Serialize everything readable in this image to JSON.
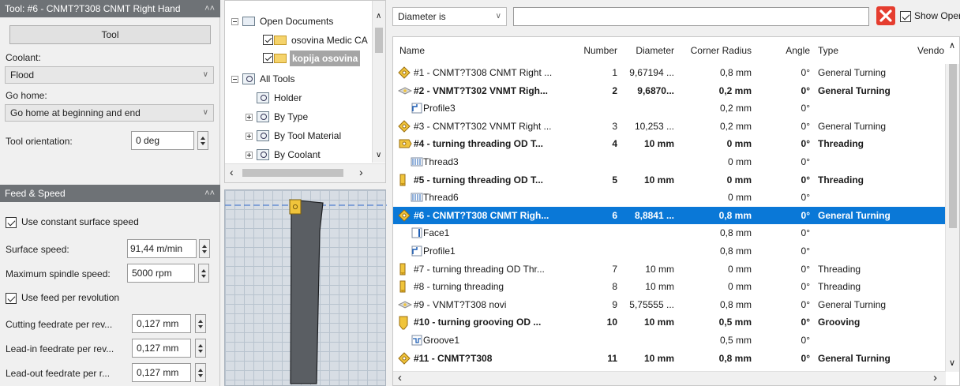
{
  "tool_panel": {
    "title": "Tool: #6 - CNMT?T308 CNMT Right Hand",
    "tool_button": "Tool",
    "coolant_label": "Coolant:",
    "coolant_value": "Flood",
    "go_home_label": "Go home:",
    "go_home_value": "Go home at beginning and end",
    "orientation_label": "Tool orientation:",
    "orientation_value": "0 deg"
  },
  "feed_speed": {
    "title": "Feed & Speed",
    "use_constant_surface_speed": "Use constant surface speed",
    "surface_speed_label": "Surface speed:",
    "surface_speed_value": "91,44 m/min",
    "max_spindle_label": "Maximum spindle speed:",
    "max_spindle_value": "5000 rpm",
    "use_feed_per_rev": "Use feed per revolution",
    "cutting_feed_label": "Cutting feedrate per rev...",
    "cutting_feed_value": "0,127 mm",
    "leadin_feed_label": "Lead-in feedrate per rev...",
    "leadin_feed_value": "0,127 mm",
    "leadout_feed_label": "Lead-out feedrate per r...",
    "leadout_feed_value": "0,127 mm"
  },
  "tree": {
    "open_documents": "Open Documents",
    "doc1": "osovina Medic CA",
    "doc2": "kopija osovina",
    "all_tools": "All Tools",
    "holder": "Holder",
    "by_type": "By Type",
    "by_tool_material": "By Tool Material",
    "by_coolant": "By Coolant"
  },
  "filter": {
    "field": "Diameter is",
    "show_operations": "Show Operations"
  },
  "list": {
    "columns": [
      "Name",
      "Number",
      "Diameter",
      "Corner Radius",
      "Angle",
      "Type",
      "Vendo"
    ],
    "rows": [
      {
        "icon": "turning-insert-icon",
        "name": "#1 - CNMT?T308 CNMT Right ...",
        "number": "1",
        "diameter": "9,67194 ...",
        "radius": "0,8 mm",
        "angle": "0°",
        "type": "General Turning",
        "bold": false,
        "indent": false
      },
      {
        "icon": "vnmt-insert-icon",
        "name": "#2 - VNMT?T302 VNMT Righ...",
        "number": "2",
        "diameter": "9,6870...",
        "radius": "0,2 mm",
        "angle": "0°",
        "type": "General Turning",
        "bold": true,
        "indent": false
      },
      {
        "icon": "profile-icon",
        "name": "Profile3",
        "number": "",
        "diameter": "",
        "radius": "0,2 mm",
        "angle": "0°",
        "type": "",
        "bold": false,
        "indent": true
      },
      {
        "icon": "turning-insert-icon",
        "name": "#3 - CNMT?T302 VNMT Right ...",
        "number": "3",
        "diameter": "10,253 ...",
        "radius": "0,2 mm",
        "angle": "0°",
        "type": "General Turning",
        "bold": false,
        "indent": false
      },
      {
        "icon": "threading-insert-icon",
        "name": "#4 - turning threading OD T...",
        "number": "4",
        "diameter": "10 mm",
        "radius": "0 mm",
        "angle": "0°",
        "type": "Threading",
        "bold": true,
        "indent": false
      },
      {
        "icon": "thread-icon",
        "name": "Thread3",
        "number": "",
        "diameter": "",
        "radius": "0 mm",
        "angle": "0°",
        "type": "",
        "bold": false,
        "indent": true
      },
      {
        "icon": "threading-tool-icon",
        "name": "#5 - turning threading OD T...",
        "number": "5",
        "diameter": "10 mm",
        "radius": "0 mm",
        "angle": "0°",
        "type": "Threading",
        "bold": true,
        "indent": false
      },
      {
        "icon": "thread-icon",
        "name": "Thread6",
        "number": "",
        "diameter": "",
        "radius": "0 mm",
        "angle": "0°",
        "type": "",
        "bold": false,
        "indent": true
      },
      {
        "icon": "turning-insert-icon",
        "name": "#6 - CNMT?T308 CNMT Righ...",
        "number": "6",
        "diameter": "8,8841 ...",
        "radius": "0,8 mm",
        "angle": "0°",
        "type": "General Turning",
        "bold": true,
        "indent": false,
        "selected": true
      },
      {
        "icon": "face-icon",
        "name": "Face1",
        "number": "",
        "diameter": "",
        "radius": "0,8 mm",
        "angle": "0°",
        "type": "",
        "bold": false,
        "indent": true
      },
      {
        "icon": "profile-icon",
        "name": "Profile1",
        "number": "",
        "diameter": "",
        "radius": "0,8 mm",
        "angle": "0°",
        "type": "",
        "bold": false,
        "indent": true
      },
      {
        "icon": "threading-tool-icon",
        "name": "#7 - turning threading OD Thr...",
        "number": "7",
        "diameter": "10 mm",
        "radius": "0 mm",
        "angle": "0°",
        "type": "Threading",
        "bold": false,
        "indent": false
      },
      {
        "icon": "threading-tool-icon",
        "name": "#8 - turning threading",
        "number": "8",
        "diameter": "10 mm",
        "radius": "0 mm",
        "angle": "0°",
        "type": "Threading",
        "bold": false,
        "indent": false
      },
      {
        "icon": "vnmt-insert-icon",
        "name": "#9 - VNMT?T308 novi",
        "number": "9",
        "diameter": "5,75555 ...",
        "radius": "0,8 mm",
        "angle": "0°",
        "type": "General Turning",
        "bold": false,
        "indent": false
      },
      {
        "icon": "grooving-tool-icon",
        "name": "#10 - turning grooving OD ...",
        "number": "10",
        "diameter": "10 mm",
        "radius": "0,5 mm",
        "angle": "0°",
        "type": "Grooving",
        "bold": true,
        "indent": false
      },
      {
        "icon": "groove-icon",
        "name": "Groove1",
        "number": "",
        "diameter": "",
        "radius": "0,5 mm",
        "angle": "0°",
        "type": "",
        "bold": false,
        "indent": true
      },
      {
        "icon": "turning-insert-icon",
        "name": "#11 - CNMT?T308",
        "number": "11",
        "diameter": "10 mm",
        "radius": "0,8 mm",
        "angle": "0°",
        "type": "General Turning",
        "bold": true,
        "indent": false
      }
    ]
  },
  "colors": {
    "selection": "#0a78d7",
    "header_bar": "#6e7276",
    "insert_gold": "#f0c43b"
  }
}
